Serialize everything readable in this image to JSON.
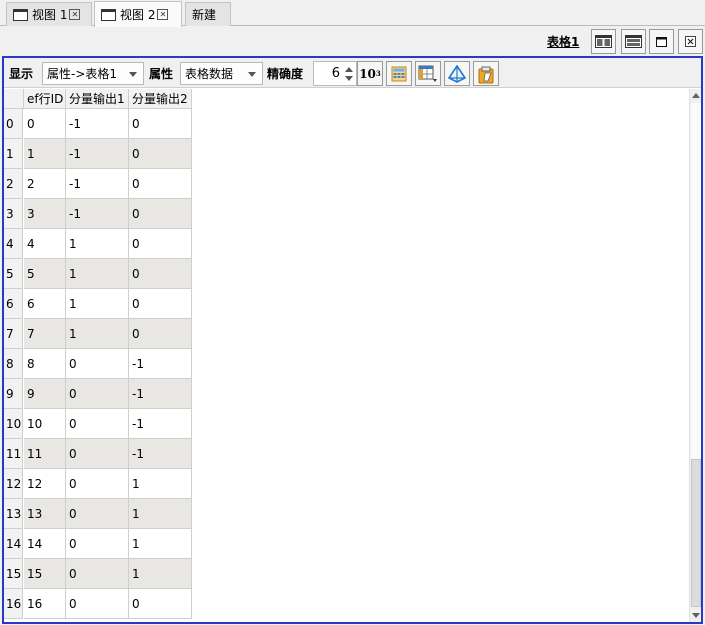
{
  "tabs": [
    {
      "label": "视图 1",
      "active": false
    },
    {
      "label": "视图 2",
      "active": true
    },
    {
      "label": "新建",
      "active": false
    }
  ],
  "title_row": {
    "table_title": "表格1",
    "buttons": [
      "split-vertical-icon",
      "split-horizontal-icon",
      "maximize-icon",
      "close-icon"
    ]
  },
  "toolbar": {
    "display_label": "显示",
    "display_value": "属性->表格1",
    "attribute_label": "属性",
    "attribute_value": "表格数据",
    "precision_label": "精确度",
    "precision_value": "6",
    "pow_button": {
      "base": "10",
      "exp": "3"
    },
    "tool_icons": [
      "calculator-icon",
      "column-chooser-icon",
      "3d-view-icon",
      "clipboard-icon"
    ]
  },
  "table": {
    "columns": [
      "ef行ID",
      "分量输出1",
      "分量输出2"
    ],
    "rows": [
      {
        "index": "0",
        "cells": [
          "0",
          "-1",
          "0"
        ]
      },
      {
        "index": "1",
        "cells": [
          "1",
          "-1",
          "0"
        ]
      },
      {
        "index": "2",
        "cells": [
          "2",
          "-1",
          "0"
        ]
      },
      {
        "index": "3",
        "cells": [
          "3",
          "-1",
          "0"
        ]
      },
      {
        "index": "4",
        "cells": [
          "4",
          "1",
          "0"
        ]
      },
      {
        "index": "5",
        "cells": [
          "5",
          "1",
          "0"
        ]
      },
      {
        "index": "6",
        "cells": [
          "6",
          "1",
          "0"
        ]
      },
      {
        "index": "7",
        "cells": [
          "7",
          "1",
          "0"
        ]
      },
      {
        "index": "8",
        "cells": [
          "8",
          "0",
          "-1"
        ]
      },
      {
        "index": "9",
        "cells": [
          "9",
          "0",
          "-1"
        ]
      },
      {
        "index": "10",
        "cells": [
          "10",
          "0",
          "-1"
        ]
      },
      {
        "index": "11",
        "cells": [
          "11",
          "0",
          "-1"
        ]
      },
      {
        "index": "12",
        "cells": [
          "12",
          "0",
          "1"
        ]
      },
      {
        "index": "13",
        "cells": [
          "13",
          "0",
          "1"
        ]
      },
      {
        "index": "14",
        "cells": [
          "14",
          "0",
          "1"
        ]
      },
      {
        "index": "15",
        "cells": [
          "15",
          "0",
          "1"
        ]
      },
      {
        "index": "16",
        "cells": [
          "16",
          "0",
          "0"
        ]
      }
    ]
  },
  "colors": {
    "panel_border": "#2838c8",
    "odd_row": "#e8e7e3"
  }
}
